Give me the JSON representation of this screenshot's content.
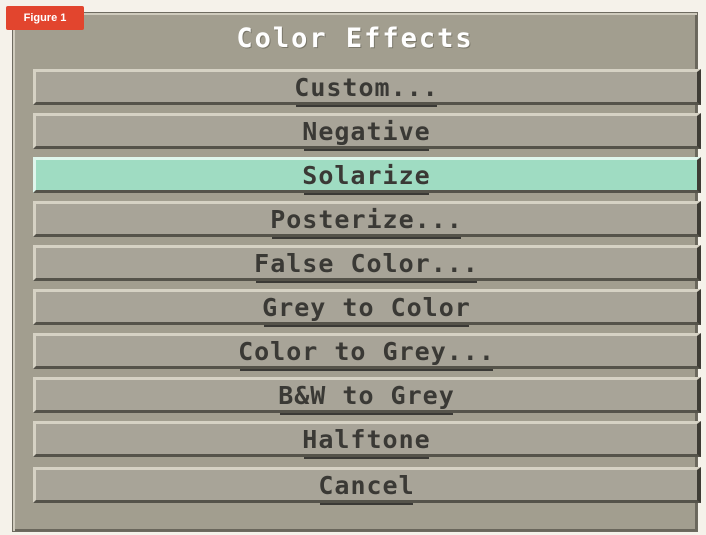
{
  "figure_label": "Figure 1",
  "dialog": {
    "title": "Color Effects"
  },
  "menu": {
    "items": [
      {
        "label": "Custom...",
        "name": "custom-button",
        "highlight": false
      },
      {
        "label": "Negative",
        "name": "negative-button",
        "highlight": false
      },
      {
        "label": "Solarize",
        "name": "solarize-button",
        "highlight": true
      },
      {
        "label": "Posterize...",
        "name": "posterize-button",
        "highlight": false
      },
      {
        "label": "False Color...",
        "name": "false-color-button",
        "highlight": false
      },
      {
        "label": "Grey to Color",
        "name": "grey-to-color-button",
        "highlight": false
      },
      {
        "label": "Color to Grey...",
        "name": "color-to-grey-button",
        "highlight": false
      },
      {
        "label": "B&W to Grey",
        "name": "bw-to-grey-button",
        "highlight": false
      },
      {
        "label": "Halftone",
        "name": "halftone-button",
        "highlight": false
      }
    ],
    "cancel_label": "Cancel"
  },
  "colors": {
    "highlight": "#9fdcc2",
    "dialog_bg": "#a29e8f",
    "button_bg": "#a8a498",
    "figure_label_bg": "#e2452e"
  }
}
